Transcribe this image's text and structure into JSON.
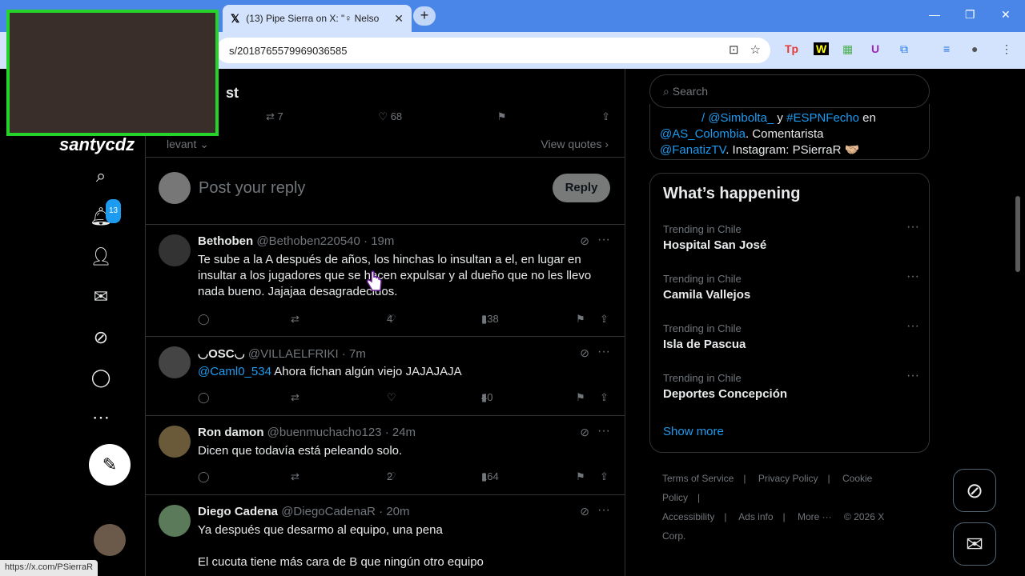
{
  "browser": {
    "tab_title": "(13) Pipe Sierra on X: \"♀ Nelso",
    "url": "s/2018765579969036585",
    "status_url": "https://x.com/PSierraR"
  },
  "webcam": {
    "name": "santycdz"
  },
  "nav": {
    "notif_count": "13"
  },
  "post": {
    "heading": "st",
    "retweets": "7",
    "likes": "68",
    "view_quotes": "View quotes",
    "sort_label": "levant"
  },
  "reply_box": {
    "placeholder": "Post your reply",
    "button": "Reply"
  },
  "tweets": [
    {
      "name": "Bethoben",
      "handle": "@Bethoben220540",
      "time": "19m",
      "text": "Te sube a la A después de años, los hinchas lo insultan a el, en lugar en insultar a los jugadores que se hacen expulsar y al dueño que no les llevo nada bueno. Jajajaa desagradecidos.",
      "likes": "4",
      "views": "138"
    },
    {
      "name": "◡OSC◡",
      "handle": "@VILLAELFRIKI",
      "time": "7m",
      "mention": "@Caml0_534",
      "text": " Ahora fichan algún viejo JAJAJAJA",
      "likes": "",
      "views": "40"
    },
    {
      "name": "Ron damon",
      "handle": "@buenmuchacho123",
      "time": "24m",
      "text": "Dicen que todavía está peleando solo.",
      "likes": "2",
      "views": "164"
    },
    {
      "name": "Diego Cadena",
      "handle": "@DiegoCadenaR",
      "time": "20m",
      "text": "Ya después que desarmo al equipo, una pena",
      "text2": "El cucuta tiene más cara de B que ningún otro equipo"
    }
  ],
  "right": {
    "search_placeholder": "Search",
    "bio_line1_a": "/ @Simbolta_",
    "bio_line1_b": " y ",
    "bio_line1_c": "#ESPNFecho",
    "bio_line1_d": " en",
    "bio_line2_m": "@AS_Colombia",
    "bio_line2_t": ". Comentarista",
    "bio_line3_m": "@FanatizTV",
    "bio_line3_t": ". Instagram: PSierraR 🤝🏼",
    "trends_title": "What’s happening",
    "trends": [
      {
        "context": "Trending in Chile",
        "topic": "Hospital San José"
      },
      {
        "context": "Trending in Chile",
        "topic": "Camila Vallejos"
      },
      {
        "context": "Trending in Chile",
        "topic": "Isla de Pascua"
      },
      {
        "context": "Trending in Chile",
        "topic": "Deportes Concepción"
      }
    ],
    "show_more": "Show more",
    "footer": {
      "terms": "Terms of Service",
      "privacy": "Privacy Policy",
      "cookie": "Cookie Policy",
      "accessibility": "Accessibility",
      "ads": "Ads info",
      "more": "More ···",
      "copyright": "© 2026 X Corp."
    }
  },
  "colors": {
    "accent": "#1d9bf0",
    "background": "#000000",
    "border": "#2f3336",
    "muted": "#71767b"
  }
}
